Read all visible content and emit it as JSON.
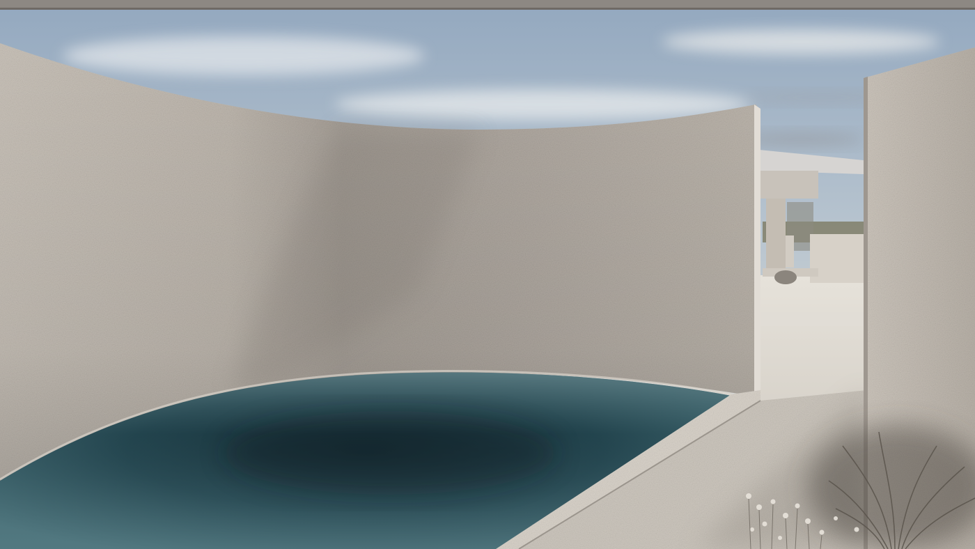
{
  "scene": {
    "palette": {
      "sky_top": "#9fb1c4",
      "sky_mid": "#c3ccd4",
      "sky_horizon": "#e6e0d6",
      "wall_lit": "#cfc8bf",
      "wall_shadow": "#9c958e",
      "water_deep": "#0f2a33",
      "water_edge": "#4f7a84",
      "ground": "#ddd8d0",
      "ceiling": "#8a8580"
    },
    "elements": [
      "sky",
      "ceiling-overhang",
      "curved-wall",
      "pool",
      "pool-coping",
      "paved-walkway",
      "distant-house",
      "right-wall-panel",
      "plants"
    ]
  }
}
